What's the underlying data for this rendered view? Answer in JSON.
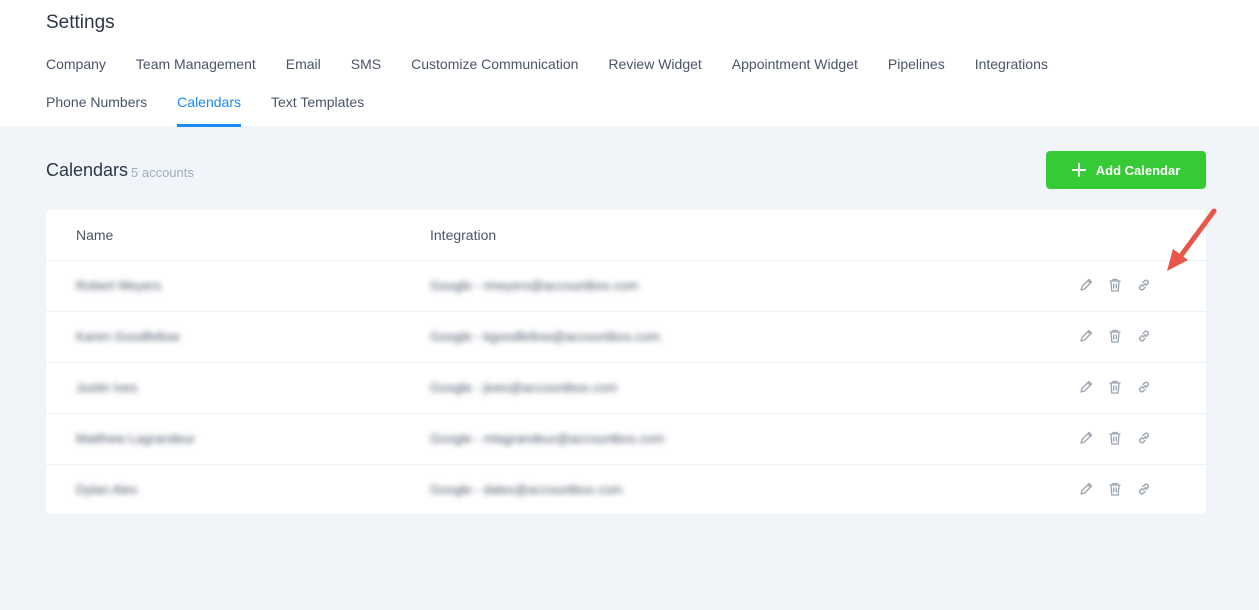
{
  "header": {
    "title": "Settings",
    "tabs_row1": [
      "Company",
      "Team Management",
      "Email",
      "SMS",
      "Customize Communication",
      "Review Widget",
      "Appointment Widget",
      "Pipelines",
      "Integrations"
    ],
    "tabs_row2": [
      "Phone Numbers",
      "Calendars",
      "Text Templates"
    ],
    "active_tab": "Calendars"
  },
  "section": {
    "title": "Calendars",
    "count": "5 accounts",
    "add_button_label": "Add Calendar"
  },
  "table": {
    "columns": [
      "Name",
      "Integration"
    ],
    "rows": [
      {
        "name": "Robert Meyers",
        "integration": "Google - rmeyers@accountbox.com"
      },
      {
        "name": "Karen Goodfellow",
        "integration": "Google - kgoodfellow@accountbox.com"
      },
      {
        "name": "Justin Ives",
        "integration": "Google - jives@accountbox.com"
      },
      {
        "name": "Matthew Lagrandeur",
        "integration": "Google - mlagrandeur@accountbox.com"
      },
      {
        "name": "Dylan Alex",
        "integration": "Google - dalex@accountbox.com"
      }
    ]
  },
  "icons": {
    "add": "plus-icon",
    "edit": "pencil-icon",
    "delete": "trash-icon",
    "link": "link-icon",
    "annotation": "arrow-annotation-icon"
  },
  "colors": {
    "accent": "#188bf6",
    "add_button": "#37ca37",
    "background": "#f1f5f9",
    "annotation_arrow": "#e8564a"
  }
}
